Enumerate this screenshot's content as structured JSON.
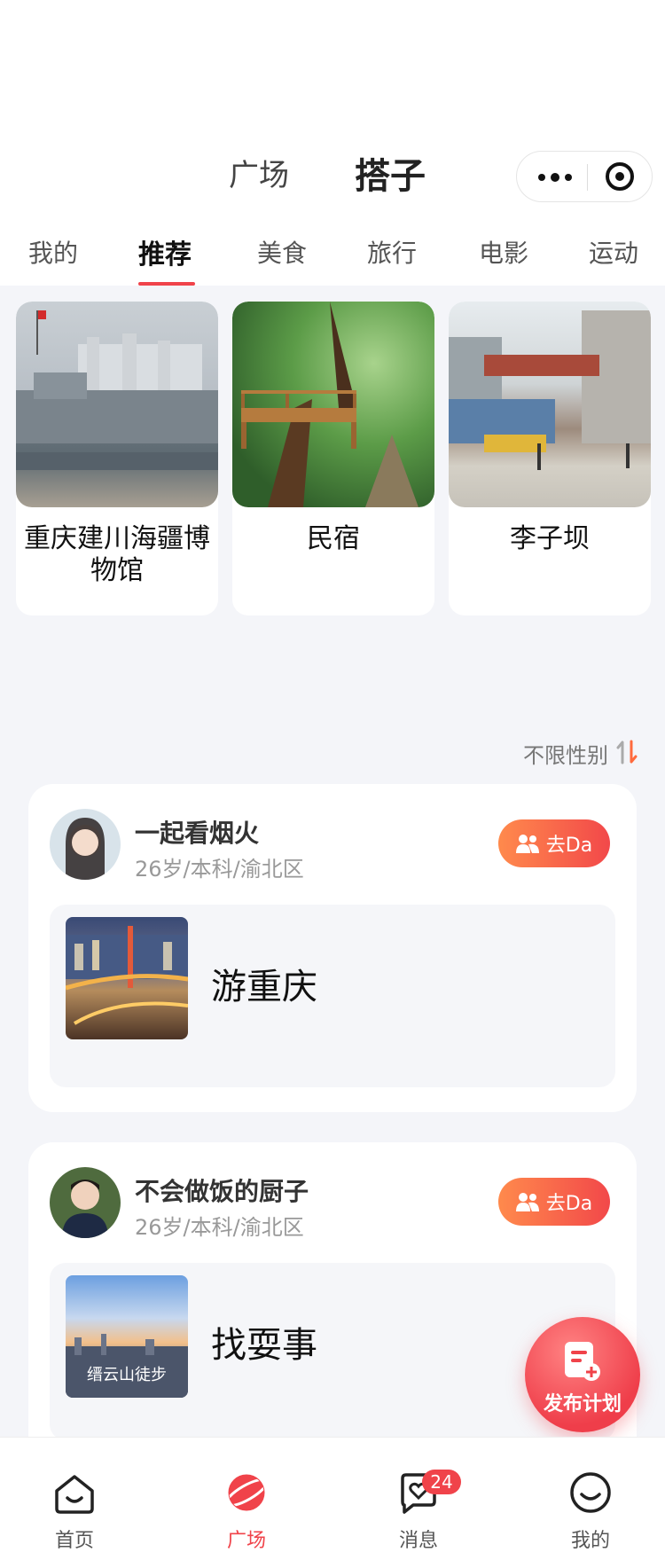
{
  "header": {
    "tabs": [
      {
        "label": "广场",
        "active": false
      },
      {
        "label": "搭子",
        "active": true
      }
    ],
    "more_icon": "more-dots-icon",
    "close_icon": "target-icon"
  },
  "sub_tabs": [
    {
      "label": "我的",
      "active": false
    },
    {
      "label": "推荐",
      "active": true
    },
    {
      "label": "美食",
      "active": false
    },
    {
      "label": "旅行",
      "active": false
    },
    {
      "label": "电影",
      "active": false
    },
    {
      "label": "运动",
      "active": false
    }
  ],
  "places": [
    {
      "name": "重庆建川海疆博物馆"
    },
    {
      "name": "民宿"
    },
    {
      "name": "李子坝"
    }
  ],
  "filter": {
    "label": "不限性别"
  },
  "posts": [
    {
      "user_name": "一起看烟火",
      "user_meta": "26岁/本科/渝北区",
      "button_label": "去Da",
      "activity_title": "游重庆",
      "thumb_label": ""
    },
    {
      "user_name": "不会做饭的厨子",
      "user_meta": "26岁/本科/渝北区",
      "button_label": "去Da",
      "activity_title": "找耍事",
      "thumb_label": "缙云山徒步"
    }
  ],
  "fab": {
    "label": "发布计划"
  },
  "bottom_nav": [
    {
      "label": "首页",
      "icon": "home-icon",
      "active": false
    },
    {
      "label": "广场",
      "icon": "planet-icon",
      "active": true
    },
    {
      "label": "消息",
      "icon": "message-heart-icon",
      "active": false,
      "badge": "24"
    },
    {
      "label": "我的",
      "icon": "profile-smile-icon",
      "active": false
    }
  ],
  "colors": {
    "accent": "#f0434a",
    "button_gradient_start": "#ff8a4c"
  }
}
